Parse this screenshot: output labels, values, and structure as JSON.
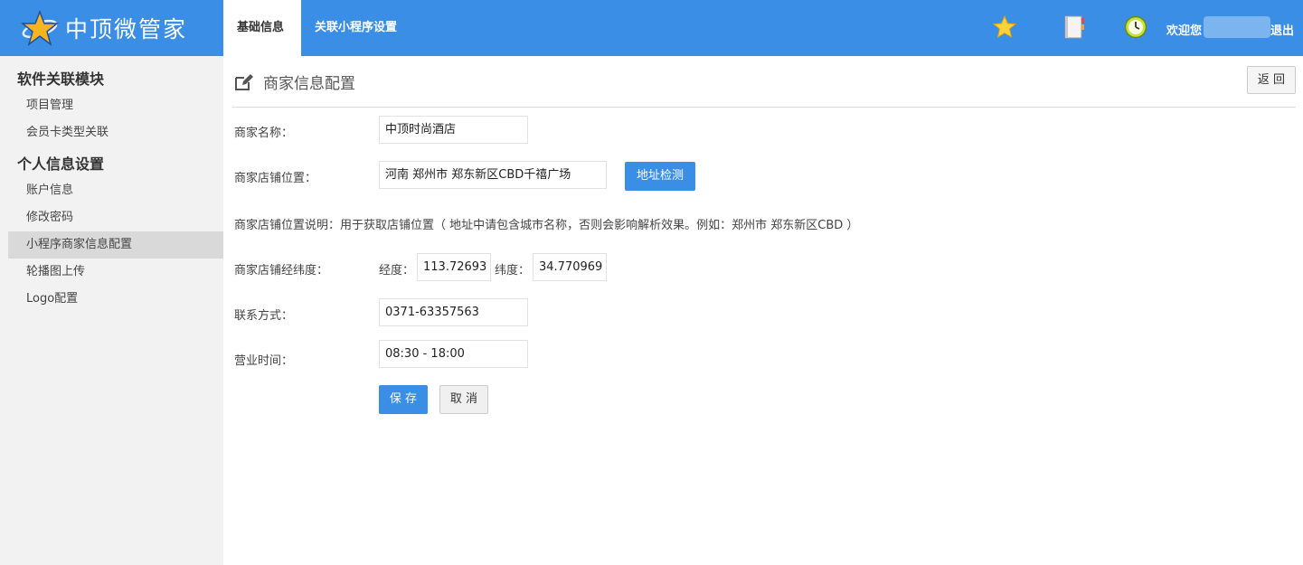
{
  "brand": {
    "name": "中顶微管家"
  },
  "topnav": {
    "tabs": [
      {
        "label": "基础信息",
        "active": true
      },
      {
        "label": "关联小程序设置",
        "active": false
      }
    ]
  },
  "topbar": {
    "icons": [
      "star-icon",
      "notebook-icon",
      "clock-icon"
    ],
    "welcome": "欢迎您",
    "logout": "退出"
  },
  "sidebar": {
    "groups": [
      {
        "title": "软件关联模块",
        "items": [
          {
            "label": "项目管理"
          },
          {
            "label": "会员卡类型关联"
          }
        ]
      },
      {
        "title": "个人信息设置",
        "items": [
          {
            "label": "账户信息"
          },
          {
            "label": "修改密码"
          },
          {
            "label": "小程序商家信息配置",
            "active": true
          },
          {
            "label": "轮播图上传"
          },
          {
            "label": "Logo配置"
          }
        ]
      }
    ]
  },
  "page": {
    "title": "商家信息配置",
    "back_label": "返 回"
  },
  "form": {
    "name_label": "商家名称：",
    "name_value": "中顶时尚酒店",
    "address_label": "商家店铺位置：",
    "address_value": "河南 郑州市 郑东新区CBD千禧广场",
    "detect_label": "地址检测",
    "address_note": "商家店铺位置说明：用于获取店铺位置（ 地址中请包含城市名称，否则会影响解析效果。例如：郑州市 郑东新区CBD ）",
    "coords_label": "商家店铺经纬度：",
    "lng_label": "经度：",
    "lng_value": "113.72693",
    "lat_label": "纬度：",
    "lat_value": "34.770969",
    "contact_label": "联系方式：",
    "contact_value": "0371-63357563",
    "hours_label": "营业时间：",
    "hours_value": "08:30 - 18:00",
    "save_label": "保 存",
    "cancel_label": "取 消"
  },
  "colors": {
    "accent": "#3a8ee6",
    "sidebar_bg": "#f2f2f2"
  }
}
